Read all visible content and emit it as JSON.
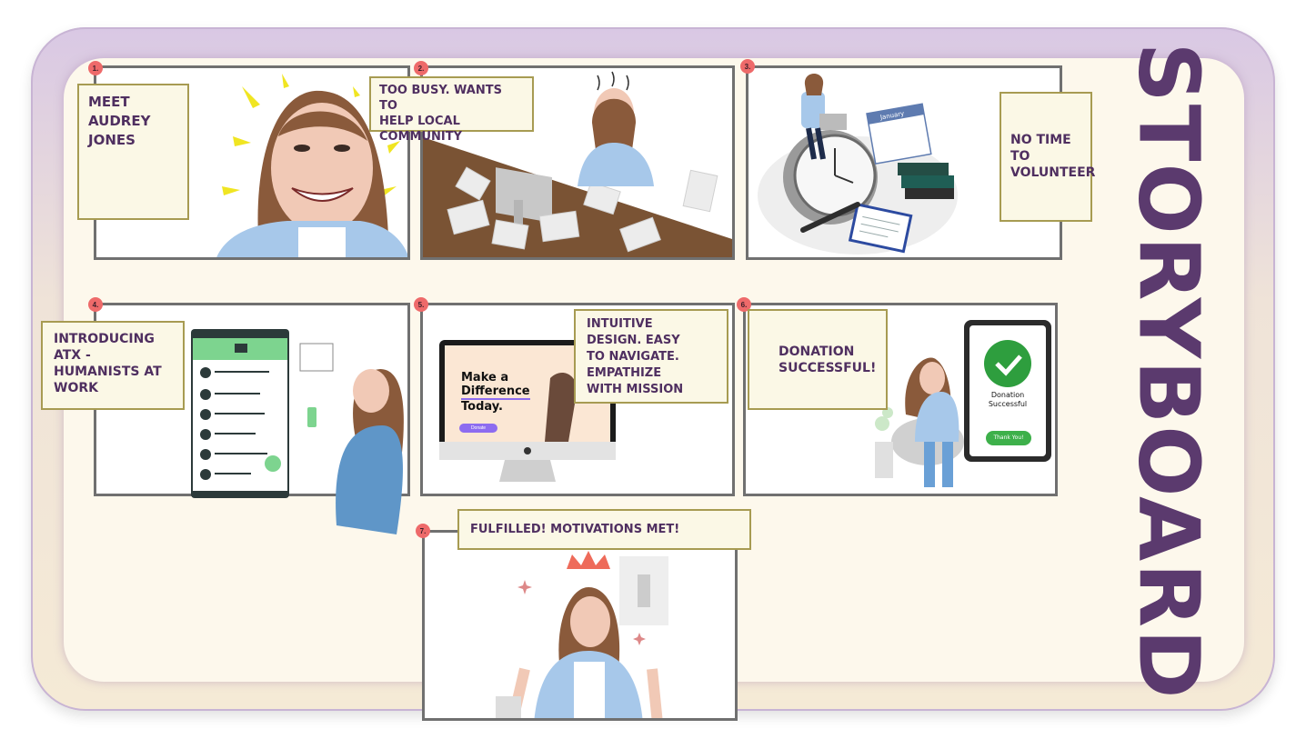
{
  "title": "STORYBOARD",
  "panels": [
    {
      "number": "1.",
      "caption": "MEET\nAUDREY\nJONES"
    },
    {
      "number": "2.",
      "caption": "TOO BUSY. WANTS TO\nHELP LOCAL\nCOMMUNITY"
    },
    {
      "number": "3.",
      "caption": "NO TIME\nTO\nVOLUNTEER"
    },
    {
      "number": "4.",
      "caption": "INTRODUCING\nATX -\nHUMANISTS AT\nWORK"
    },
    {
      "number": "5.",
      "caption": "INTUITIVE\nDESIGN. EASY\nTO NAVIGATE.\nEMPATHIZE\nWITH MISSION"
    },
    {
      "number": "6.",
      "caption": "DONATION\nSUCCESSFUL!"
    },
    {
      "number": "7.",
      "caption": "FULFILLED! MOTIVATIONS MET!"
    }
  ],
  "screen_texts": {
    "website_headline_1": "Make a",
    "website_headline_2": "Difference",
    "website_headline_3": "Today.",
    "website_button": "Donate",
    "calendar_label": "January",
    "phone_status": "Donation\nSuccessful",
    "phone_button": "Thank You!"
  },
  "colors": {
    "title": "#5b3a6e",
    "caption_text": "#4f2f60",
    "caption_bg": "#fbf8e6",
    "caption_border": "#a79b52",
    "number_badge": "#ee6a6a",
    "panel_border": "#707070",
    "success_green": "#2e9e3e"
  }
}
